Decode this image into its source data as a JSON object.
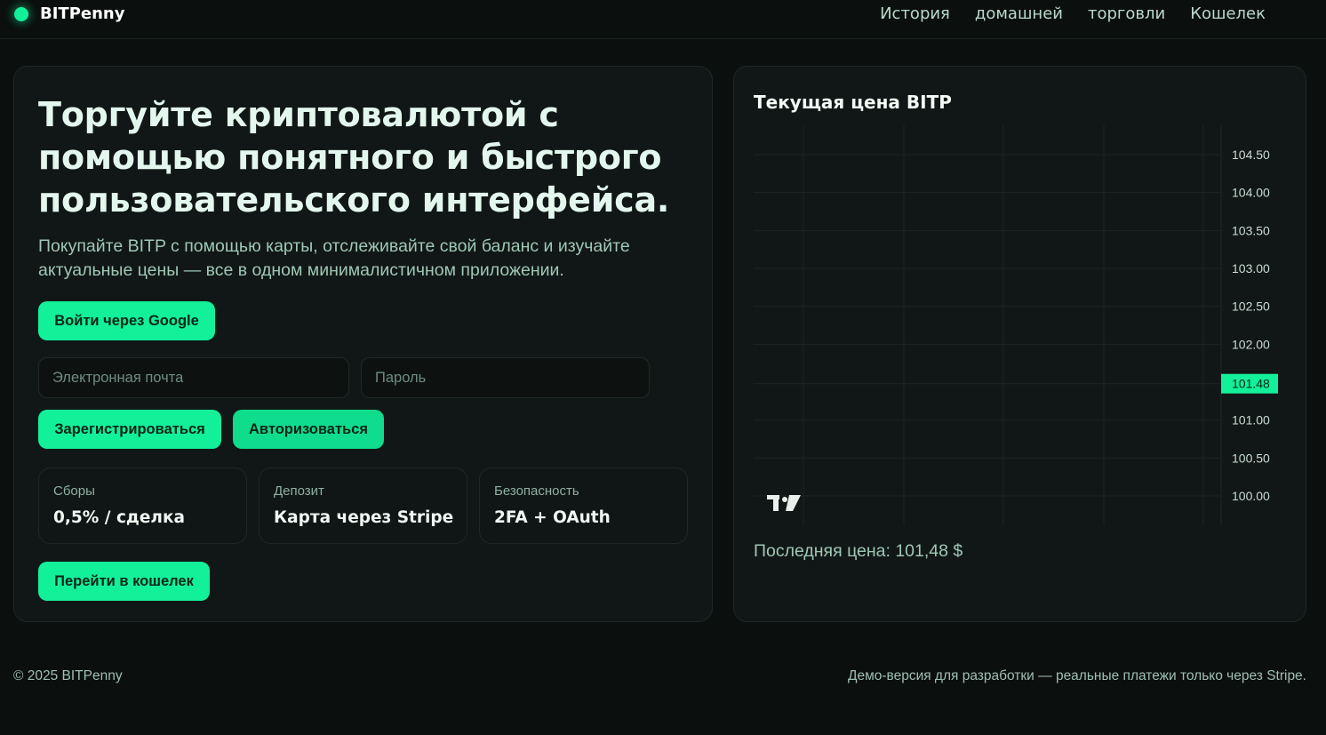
{
  "header": {
    "brand": "BITPenny",
    "nav": [
      "История",
      "домашней",
      "торговли",
      "Кошелек"
    ]
  },
  "hero": {
    "title": "Торгуйте криптовалютой с помощью понятного и быстрого пользовательского интерфейса.",
    "subtitle": "Покупайте BITP с помощью карты, отслеживайте свой баланс и изучайте актуальные цены — все в одном минималистичном приложении.",
    "google_button": "Войти через Google",
    "email_placeholder": "Электронная почта",
    "password_placeholder": "Пароль",
    "register_button": "Зарегистрироваться",
    "login_button": "Авторизоваться",
    "stats": [
      {
        "label": "Сборы",
        "value": "0,5% / сделка"
      },
      {
        "label": "Депозит",
        "value": "Карта через Stripe"
      },
      {
        "label": "Безопасность",
        "value": "2FA + OAuth"
      }
    ],
    "wallet_button": "Перейти в кошелек"
  },
  "chart_card": {
    "title": "Текущая цена BITP",
    "last_price": "Последняя цена: 101,48 $",
    "watermark": "TV"
  },
  "chart_data": {
    "type": "line",
    "title": "Текущая цена BITP",
    "series": [],
    "y_ticks": [
      "104.50",
      "104.00",
      "103.50",
      "103.00",
      "102.50",
      "102.00",
      "101.00",
      "100.50",
      "100.00"
    ],
    "y_tick_values": [
      104.5,
      104.0,
      103.5,
      103.0,
      102.5,
      102.0,
      101.0,
      100.5,
      100.0
    ],
    "current_value": 101.48,
    "current_label": "101.48",
    "ylim": [
      99.5,
      105.0
    ],
    "grid": true,
    "accent": "#12f09a"
  },
  "footer": {
    "copyright": "© 2025 BITPenny",
    "note": "Демо-версия для разработки — реальные платежи только через Stripe."
  },
  "colors": {
    "accent": "#12f09a",
    "background": "#0b0f0e",
    "card": "#111716"
  }
}
